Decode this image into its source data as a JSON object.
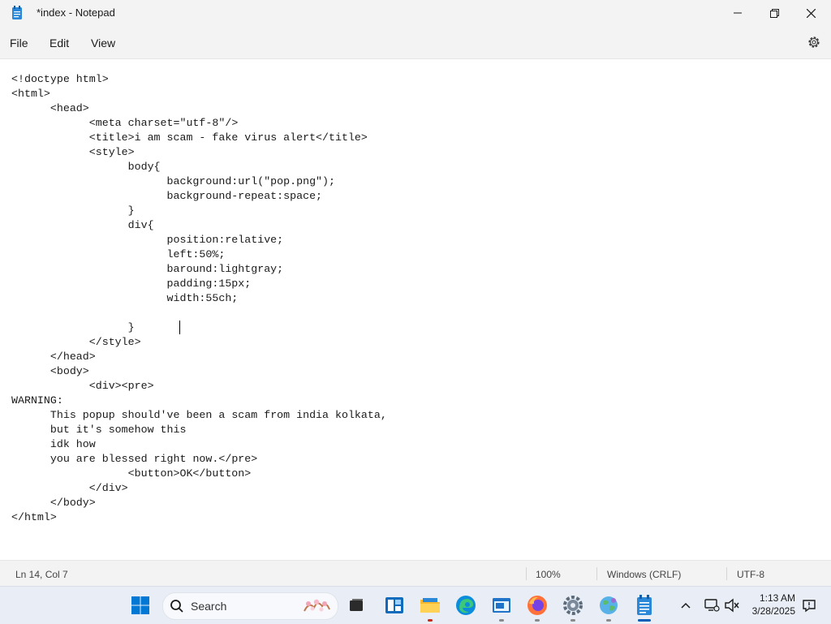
{
  "window": {
    "title": "*index - Notepad"
  },
  "menu": {
    "file": "File",
    "edit": "Edit",
    "view": "View"
  },
  "editor": {
    "lines": [
      "<!doctype html>",
      "<html>",
      "\t<head>",
      "\t\t<meta charset=\"utf-8\"/>",
      "\t\t<title>i am scam - fake virus alert</title>",
      "\t\t<style>",
      "\t\t\tbody{",
      "\t\t\t\tbackground:url(\"pop.png\");",
      "\t\t\t\tbackground-repeat:space;",
      "\t\t\t}",
      "\t\t\tdiv{",
      "\t\t\t\tposition:relative;",
      "\t\t\t\tleft:50%;",
      "\t\t\t\tbaround:lightgray;",
      "\t\t\t\tpadding:15px;",
      "\t\t\t\twidth:55ch;",
      "",
      "\t\t\t}",
      "\t\t</style>",
      "\t</head>",
      "\t<body>",
      "\t\t<div><pre>",
      "WARNING:",
      "\tThis popup should've been a scam from india kolkata,",
      "\tbut it's somehow this",
      "\tidk how",
      "\tyou are blessed right now.</pre>",
      "\t\t\t<button>OK</button>",
      "\t\t</div>",
      "\t</body>",
      "</html>"
    ]
  },
  "status": {
    "position": "Ln 14, Col 7",
    "zoom": "100%",
    "line_ending": "Windows (CRLF)",
    "encoding": "UTF-8"
  },
  "taskbar": {
    "search_label": "Search",
    "time": "1:13 AM",
    "date": "3/28/2025",
    "items": [
      "start-icon",
      "search-icon",
      "task-view-icon",
      "widgets-icon",
      "file-explorer-icon",
      "edge-icon",
      "window-app-icon",
      "firefox-icon",
      "settings-icon",
      "globe-app-icon",
      "notepad-icon"
    ]
  },
  "colors": {
    "accent": "#005fb8",
    "titlebar": "#f3f3f3",
    "taskbar": "#e9eef6"
  }
}
